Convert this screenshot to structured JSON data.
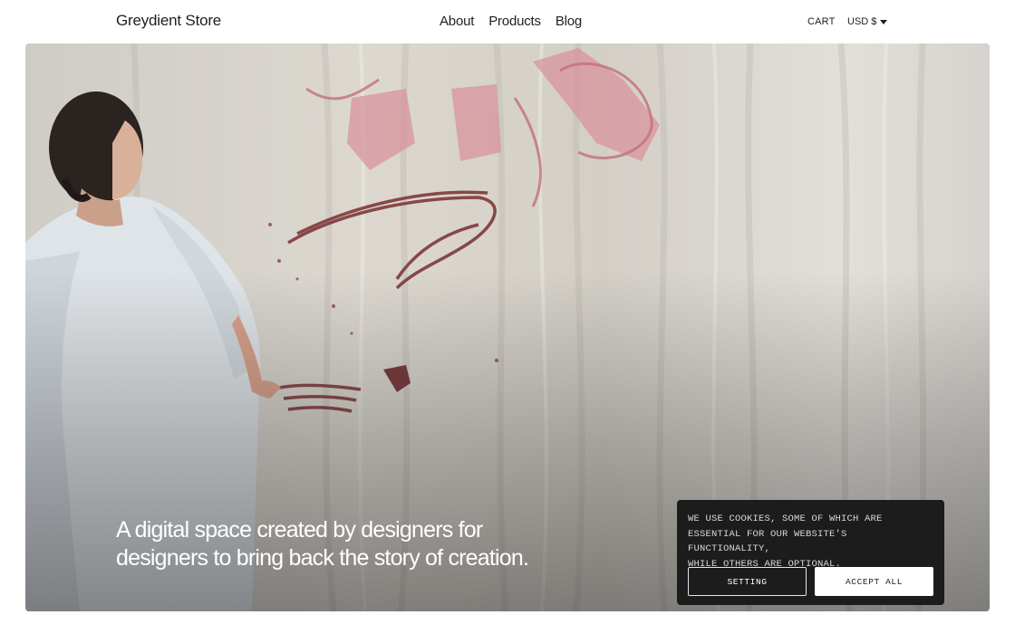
{
  "header": {
    "brand": "Greydient Store",
    "nav": [
      "About",
      "Products",
      "Blog"
    ],
    "cart": "CART",
    "currency": "USD $"
  },
  "hero": {
    "headline_line1": "A digital space created by designers for",
    "headline_line2": "designers to bring back the story of creation."
  },
  "cookie": {
    "line1": "WE USE COOKIES, SOME OF WHICH ARE",
    "line2": "ESSENTIAL FOR OUR WEBSITE'S FUNCTIONALITY,",
    "line3": "WHILE OTHERS ARE OPTIONAL.",
    "setting_label": "SETTING",
    "accept_label": "ACCEPT ALL"
  },
  "colors": {
    "cookie_bg": "#1c1c1c",
    "text": "#1f1f1f",
    "paint": "#b5556a"
  },
  "icons": [
    "caret-down-icon"
  ]
}
